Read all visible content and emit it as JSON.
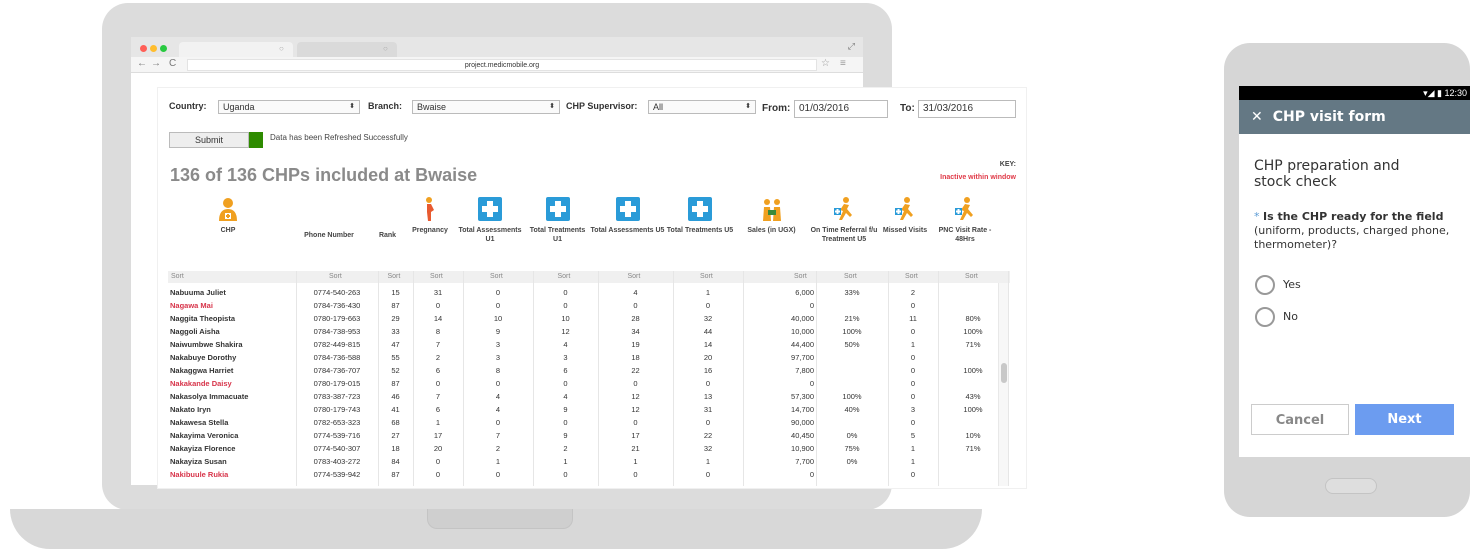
{
  "browser": {
    "url": "project.medicmobile.org"
  },
  "filters": {
    "country_label": "Country:",
    "country_value": "Uganda",
    "branch_label": "Branch:",
    "branch_value": "Bwaise",
    "supervisor_label": "CHP Supervisor:",
    "supervisor_value": "All",
    "from_label": "From:",
    "from_value": "01/03/2016",
    "to_label": "To:",
    "to_value": "31/03/2016"
  },
  "actions": {
    "submit_label": "Submit",
    "refresh_message": "Data has been Refreshed Successfully"
  },
  "report": {
    "title": "136 of 136 CHPs included at Bwaise",
    "key_label": "KEY:",
    "key_value": "Inactive within window"
  },
  "columns": [
    {
      "label": "CHP",
      "icon": "nurse-icon"
    },
    {
      "label": "Phone Number"
    },
    {
      "label": "Rank"
    },
    {
      "label": "Pregnancy",
      "icon": "pregnant-woman-icon"
    },
    {
      "label": "Total Assessments U1",
      "icon": "medical-cross-icon"
    },
    {
      "label": "Total Treatments U1",
      "icon": "medical-cross-icon"
    },
    {
      "label": "Total Assessments U5",
      "icon": "medical-cross-icon"
    },
    {
      "label": "Total Treatments U5",
      "icon": "medical-cross-icon"
    },
    {
      "label": "Sales (in UGX)",
      "icon": "sales-icon"
    },
    {
      "label": "On Time Referral f/u Treatment U5",
      "icon": "running-person-icon"
    },
    {
      "label": "Missed Visits",
      "icon": "running-person-icon"
    },
    {
      "label": "PNC Visit Rate - 48Hrs",
      "icon": "running-person-icon"
    }
  ],
  "sort_label": "Sort",
  "rows": [
    {
      "name": "Nabuuma Juliet",
      "inactive": false,
      "cells": [
        "0774-540-263",
        "15",
        "31",
        "0",
        "0",
        "4",
        "1",
        "6,000",
        "33%",
        "2",
        ""
      ]
    },
    {
      "name": "Nagawa Mai",
      "inactive": true,
      "cells": [
        "0784-736-430",
        "87",
        "0",
        "0",
        "0",
        "0",
        "0",
        "0",
        "",
        "0",
        ""
      ]
    },
    {
      "name": "Naggita Theopista",
      "inactive": false,
      "cells": [
        "0780-179-663",
        "29",
        "14",
        "10",
        "10",
        "28",
        "32",
        "40,000",
        "21%",
        "11",
        "80%"
      ]
    },
    {
      "name": "Naggoli Aisha",
      "inactive": false,
      "cells": [
        "0784-738-953",
        "33",
        "8",
        "9",
        "12",
        "34",
        "44",
        "10,000",
        "100%",
        "0",
        "100%"
      ]
    },
    {
      "name": "Naiwumbwe Shakira",
      "inactive": false,
      "cells": [
        "0782-449-815",
        "47",
        "7",
        "3",
        "4",
        "19",
        "14",
        "44,400",
        "50%",
        "1",
        "71%"
      ]
    },
    {
      "name": "Nakabuye Dorothy",
      "inactive": false,
      "cells": [
        "0784-736-588",
        "55",
        "2",
        "3",
        "3",
        "18",
        "20",
        "97,700",
        "",
        "0",
        ""
      ]
    },
    {
      "name": "Nakaggwa Harriet",
      "inactive": false,
      "cells": [
        "0784-736-707",
        "52",
        "6",
        "8",
        "6",
        "22",
        "16",
        "7,800",
        "",
        "0",
        "100%"
      ]
    },
    {
      "name": "Nakakande Daisy",
      "inactive": true,
      "cells": [
        "0780-179-015",
        "87",
        "0",
        "0",
        "0",
        "0",
        "0",
        "0",
        "",
        "0",
        ""
      ]
    },
    {
      "name": "Nakasolya Immacuate",
      "inactive": false,
      "cells": [
        "0783-387-723",
        "46",
        "7",
        "4",
        "4",
        "12",
        "13",
        "57,300",
        "100%",
        "0",
        "43%"
      ]
    },
    {
      "name": "Nakato Iryn",
      "inactive": false,
      "cells": [
        "0780-179-743",
        "41",
        "6",
        "4",
        "9",
        "12",
        "31",
        "14,700",
        "40%",
        "3",
        "100%"
      ]
    },
    {
      "name": "Nakawesa Stella",
      "inactive": false,
      "cells": [
        "0782-653-323",
        "68",
        "1",
        "0",
        "0",
        "0",
        "0",
        "90,000",
        "",
        "0",
        ""
      ]
    },
    {
      "name": "Nakayima Veronica",
      "inactive": false,
      "cells": [
        "0774-539-716",
        "27",
        "17",
        "7",
        "9",
        "17",
        "22",
        "40,450",
        "0%",
        "5",
        "10%"
      ]
    },
    {
      "name": "Nakayiza Florence",
      "inactive": false,
      "cells": [
        "0774-540-307",
        "18",
        "20",
        "2",
        "2",
        "21",
        "32",
        "10,900",
        "75%",
        "1",
        "71%"
      ]
    },
    {
      "name": "Nakayiza Susan",
      "inactive": false,
      "cells": [
        "0783-403-272",
        "84",
        "0",
        "1",
        "1",
        "1",
        "1",
        "7,700",
        "0%",
        "1",
        ""
      ]
    },
    {
      "name": "Nakibuule Rukia",
      "inactive": true,
      "cells": [
        "0774-539-942",
        "87",
        "0",
        "0",
        "0",
        "0",
        "0",
        "0",
        "",
        "0",
        ""
      ]
    }
  ],
  "phone": {
    "status_time": "12:30",
    "form_title": "CHP visit form",
    "section_title": "CHP preparation and stock check",
    "required_mark": "*",
    "question_bold": "Is the CHP ready for the field",
    "question_rest": "(uniform, products, charged phone, thermometer)?",
    "option_yes": "Yes",
    "option_no": "No",
    "cancel_label": "Cancel",
    "next_label": "Next"
  },
  "colors": {
    "inactive": "#d7344a",
    "brand_bar": "#647884",
    "next_button": "#6c9cf0",
    "success": "#2e8b00",
    "icon_orange": "#f0a020",
    "icon_blue": "#2a9bd8"
  }
}
